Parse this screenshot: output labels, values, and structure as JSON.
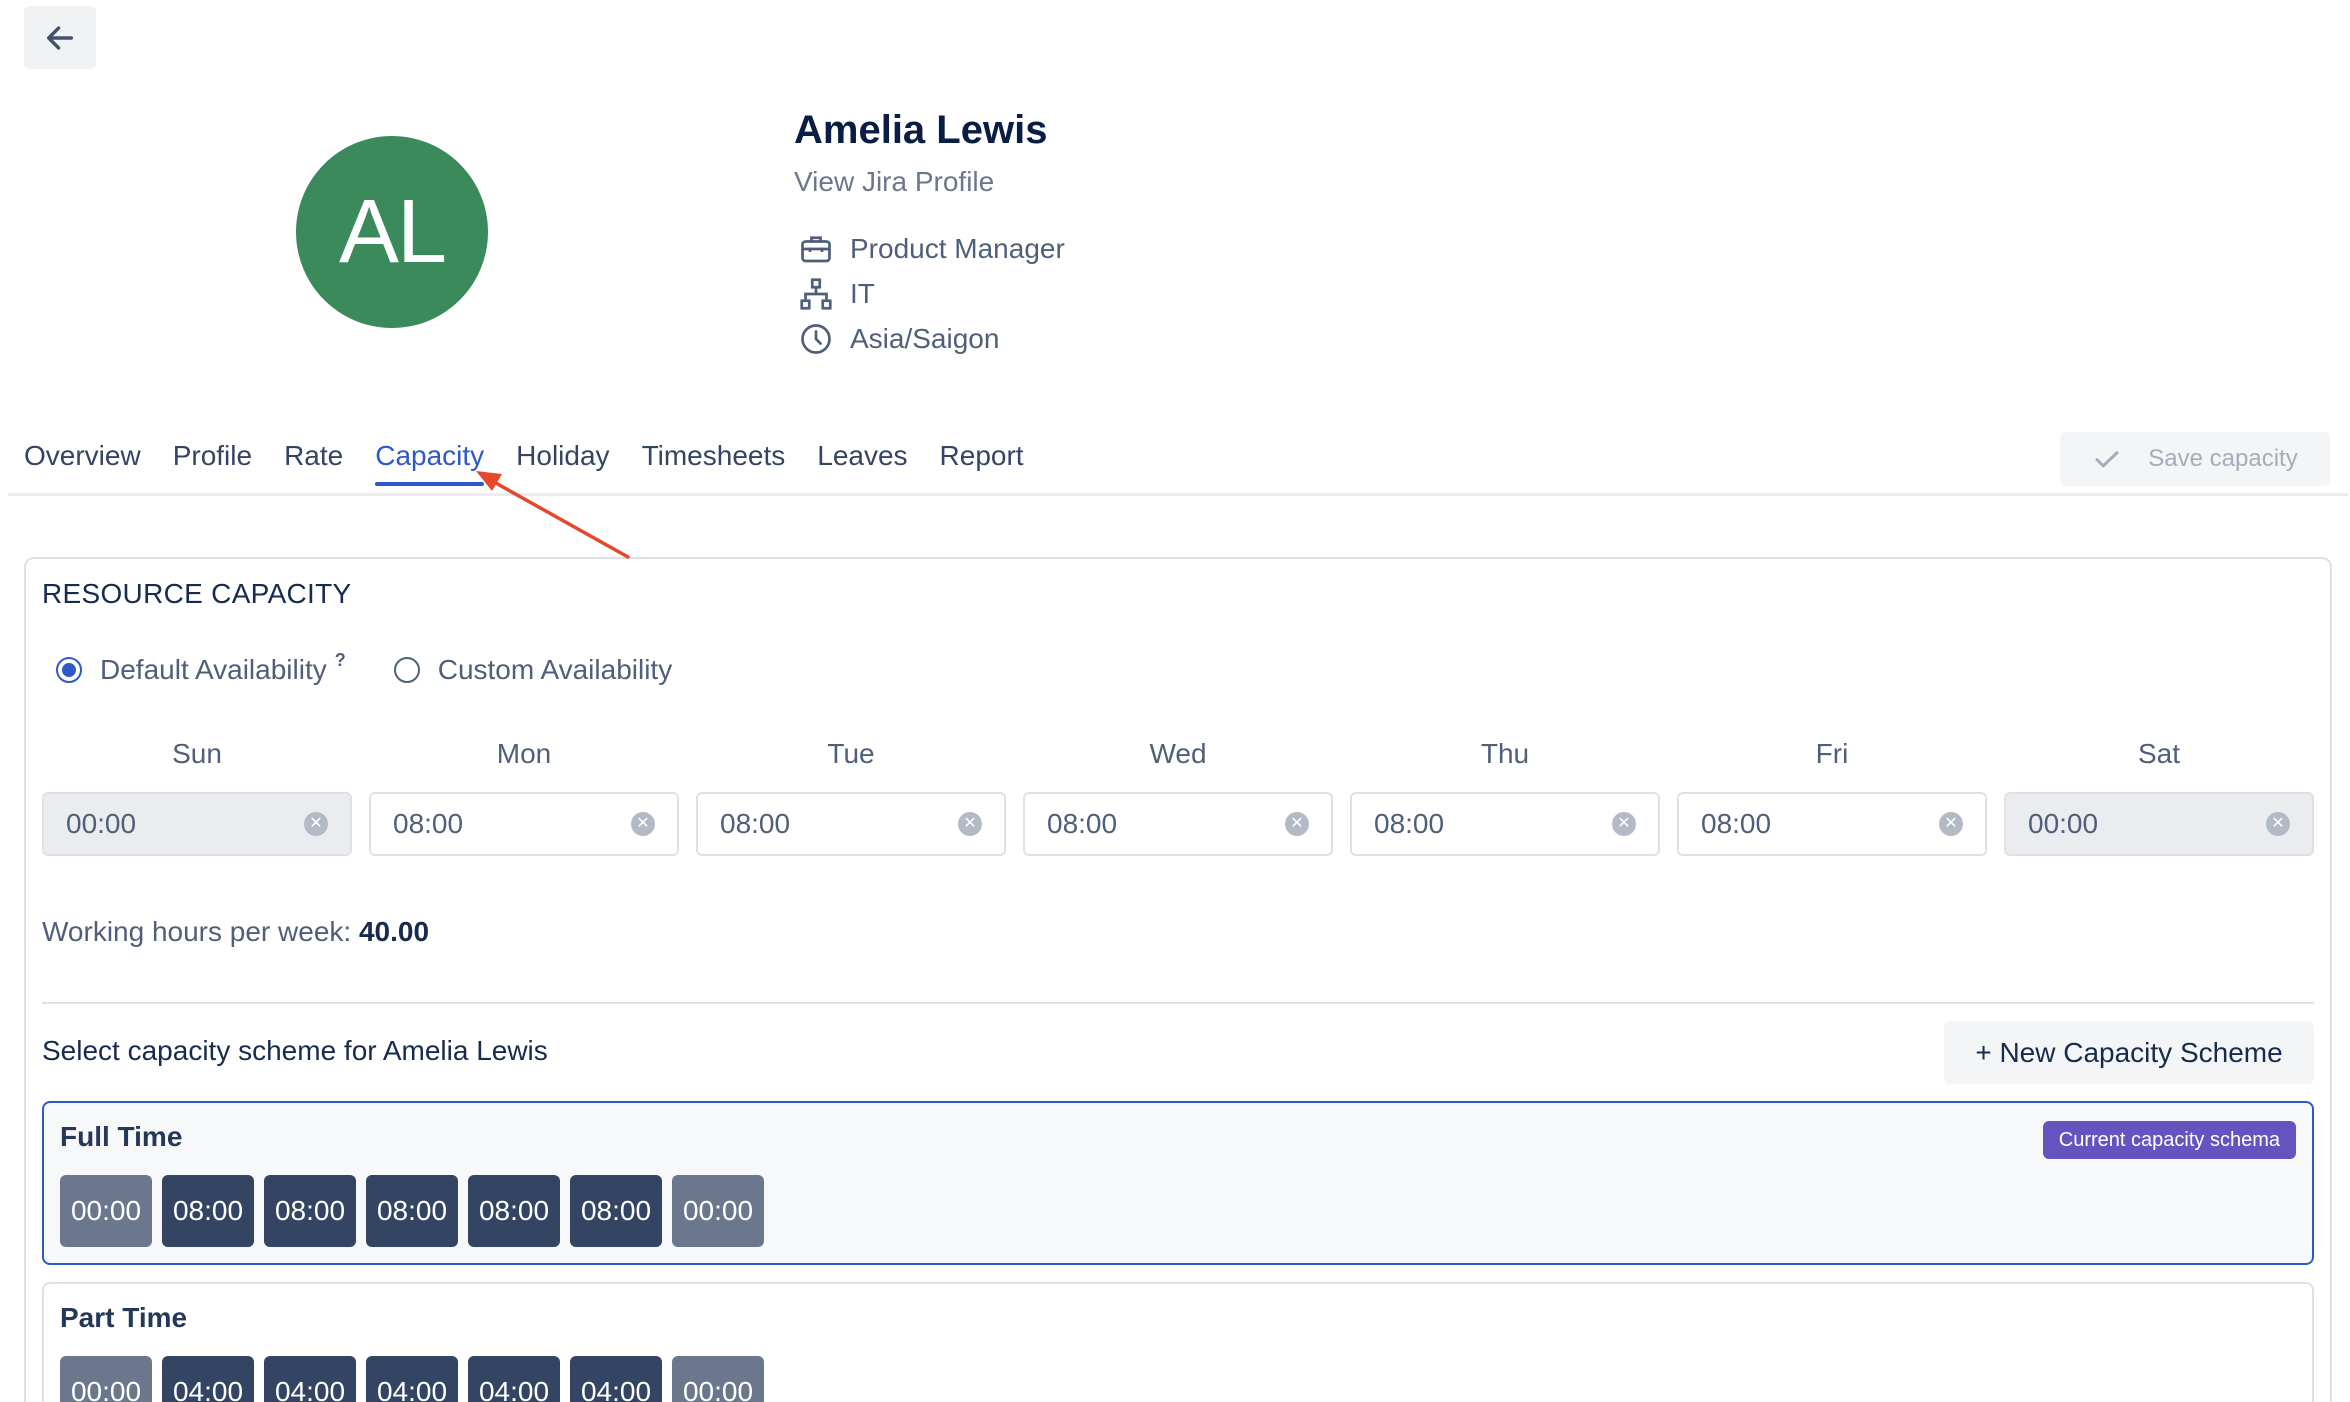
{
  "user": {
    "initials": "AL",
    "name": "Amelia Lewis",
    "profile_link": "View Jira Profile",
    "job_title": "Product Manager",
    "department": "IT",
    "timezone": "Asia/Saigon",
    "avatar_color": "#3a8a5c"
  },
  "tabs": [
    {
      "label": "Overview"
    },
    {
      "label": "Profile"
    },
    {
      "label": "Rate"
    },
    {
      "label": "Capacity",
      "active": true
    },
    {
      "label": "Holiday"
    },
    {
      "label": "Timesheets"
    },
    {
      "label": "Leaves"
    },
    {
      "label": "Report"
    }
  ],
  "toolbar": {
    "save_label": "Save capacity"
  },
  "capacity": {
    "section_title": "RESOURCE CAPACITY",
    "options": {
      "default_label": "Default Availability",
      "help_mark": "?",
      "custom_label": "Custom Availability",
      "selected": "default"
    },
    "days": [
      {
        "label": "Sun",
        "value": "00:00",
        "disabled": true
      },
      {
        "label": "Mon",
        "value": "08:00",
        "disabled": false
      },
      {
        "label": "Tue",
        "value": "08:00",
        "disabled": false
      },
      {
        "label": "Wed",
        "value": "08:00",
        "disabled": false
      },
      {
        "label": "Thu",
        "value": "08:00",
        "disabled": false
      },
      {
        "label": "Fri",
        "value": "08:00",
        "disabled": false
      },
      {
        "label": "Sat",
        "value": "00:00",
        "disabled": true
      }
    ],
    "hours_label": "Working hours per week:",
    "hours_value": "40.00"
  },
  "schemes": {
    "select_label": "Select capacity scheme for Amelia Lewis",
    "new_button": "+ New Capacity Scheme",
    "current_badge": "Current capacity schema",
    "items": [
      {
        "name": "Full Time",
        "current": true,
        "hours": [
          "00:00",
          "08:00",
          "08:00",
          "08:00",
          "08:00",
          "08:00",
          "00:00"
        ]
      },
      {
        "name": "Part Time",
        "current": false,
        "hours": [
          "00:00",
          "04:00",
          "04:00",
          "04:00",
          "04:00",
          "04:00",
          "00:00"
        ]
      }
    ]
  },
  "colors": {
    "accent": "#2d5ac8",
    "badge": "#6554c0",
    "chip_workday": "#344563",
    "chip_weekend": "#6b778c",
    "annotation_arrow": "#e5482d"
  }
}
